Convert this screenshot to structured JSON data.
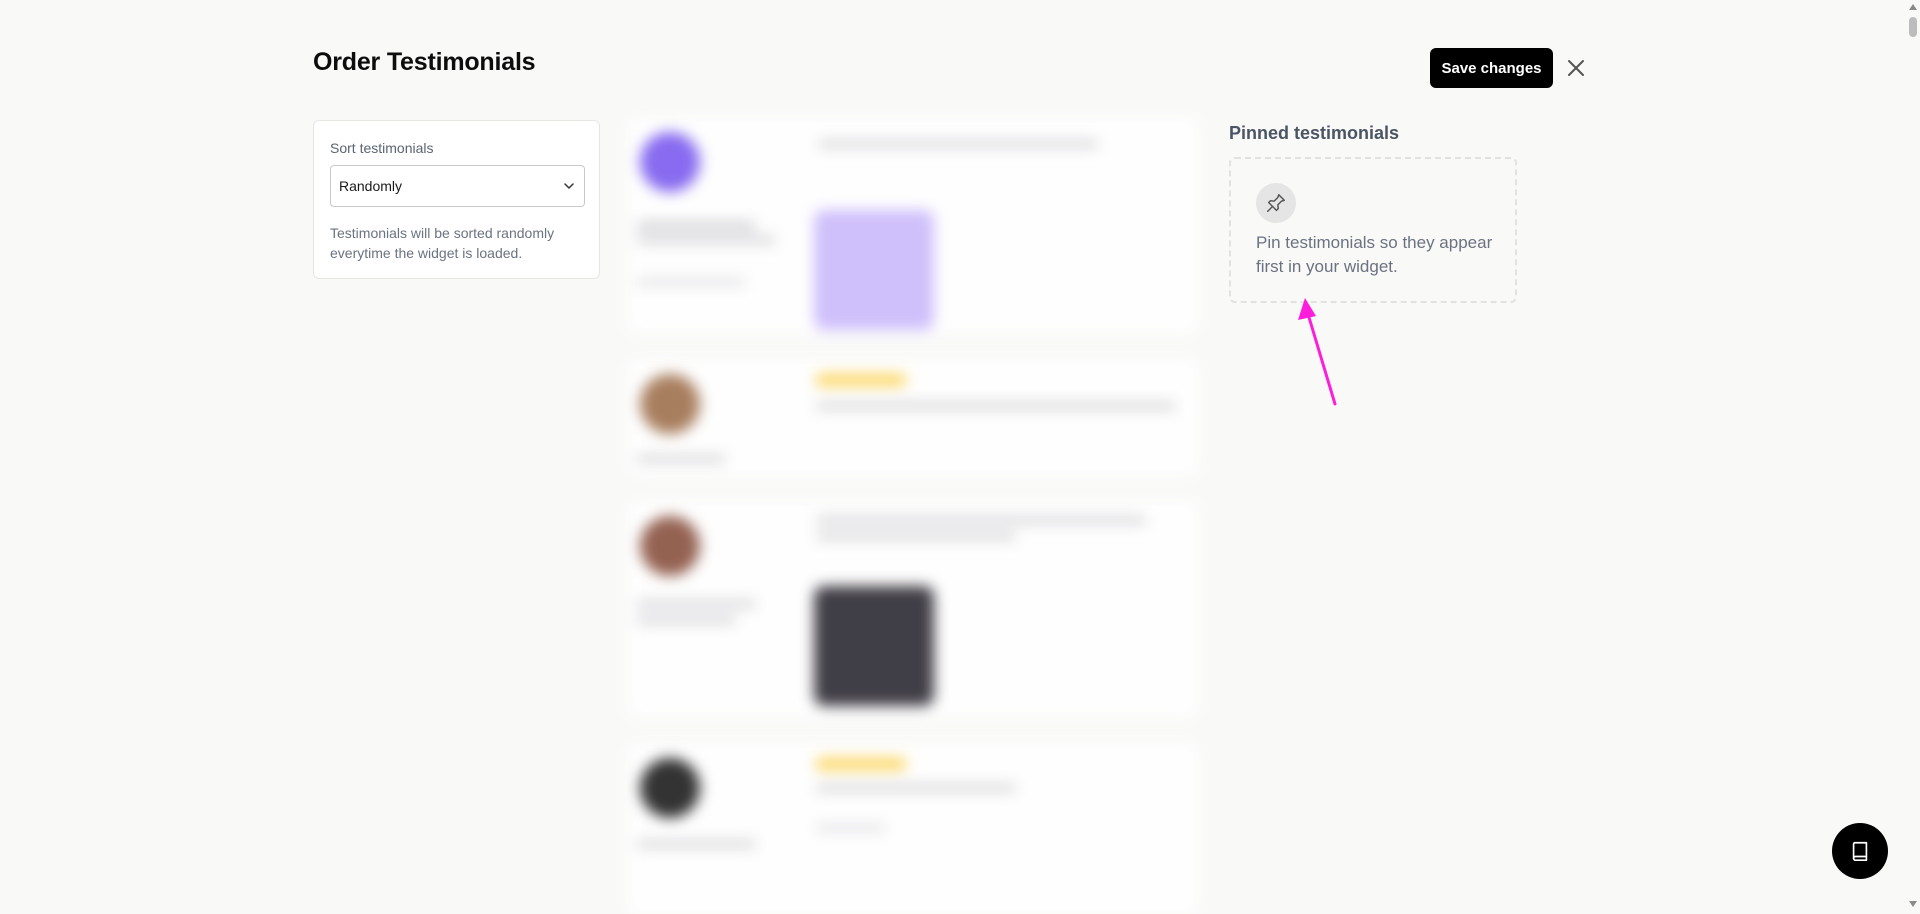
{
  "page": {
    "title": "Order Testimonials",
    "save_label": "Save changes",
    "close_icon": "close-icon"
  },
  "sort": {
    "label": "Sort testimonials",
    "selected": "Randomly",
    "help": "Testimonials will be sorted randomly everytime the widget is loaded."
  },
  "pinned": {
    "title": "Pinned testimonials",
    "empty_text": "Pin testimonials so they appear first in your widget.",
    "icon": "pin-icon"
  },
  "annotation": {
    "arrow_color": "#ff1ddc"
  },
  "fab": {
    "icon": "book-icon"
  },
  "colors": {
    "primary_button": "#000000",
    "background": "#f9f9f8"
  }
}
